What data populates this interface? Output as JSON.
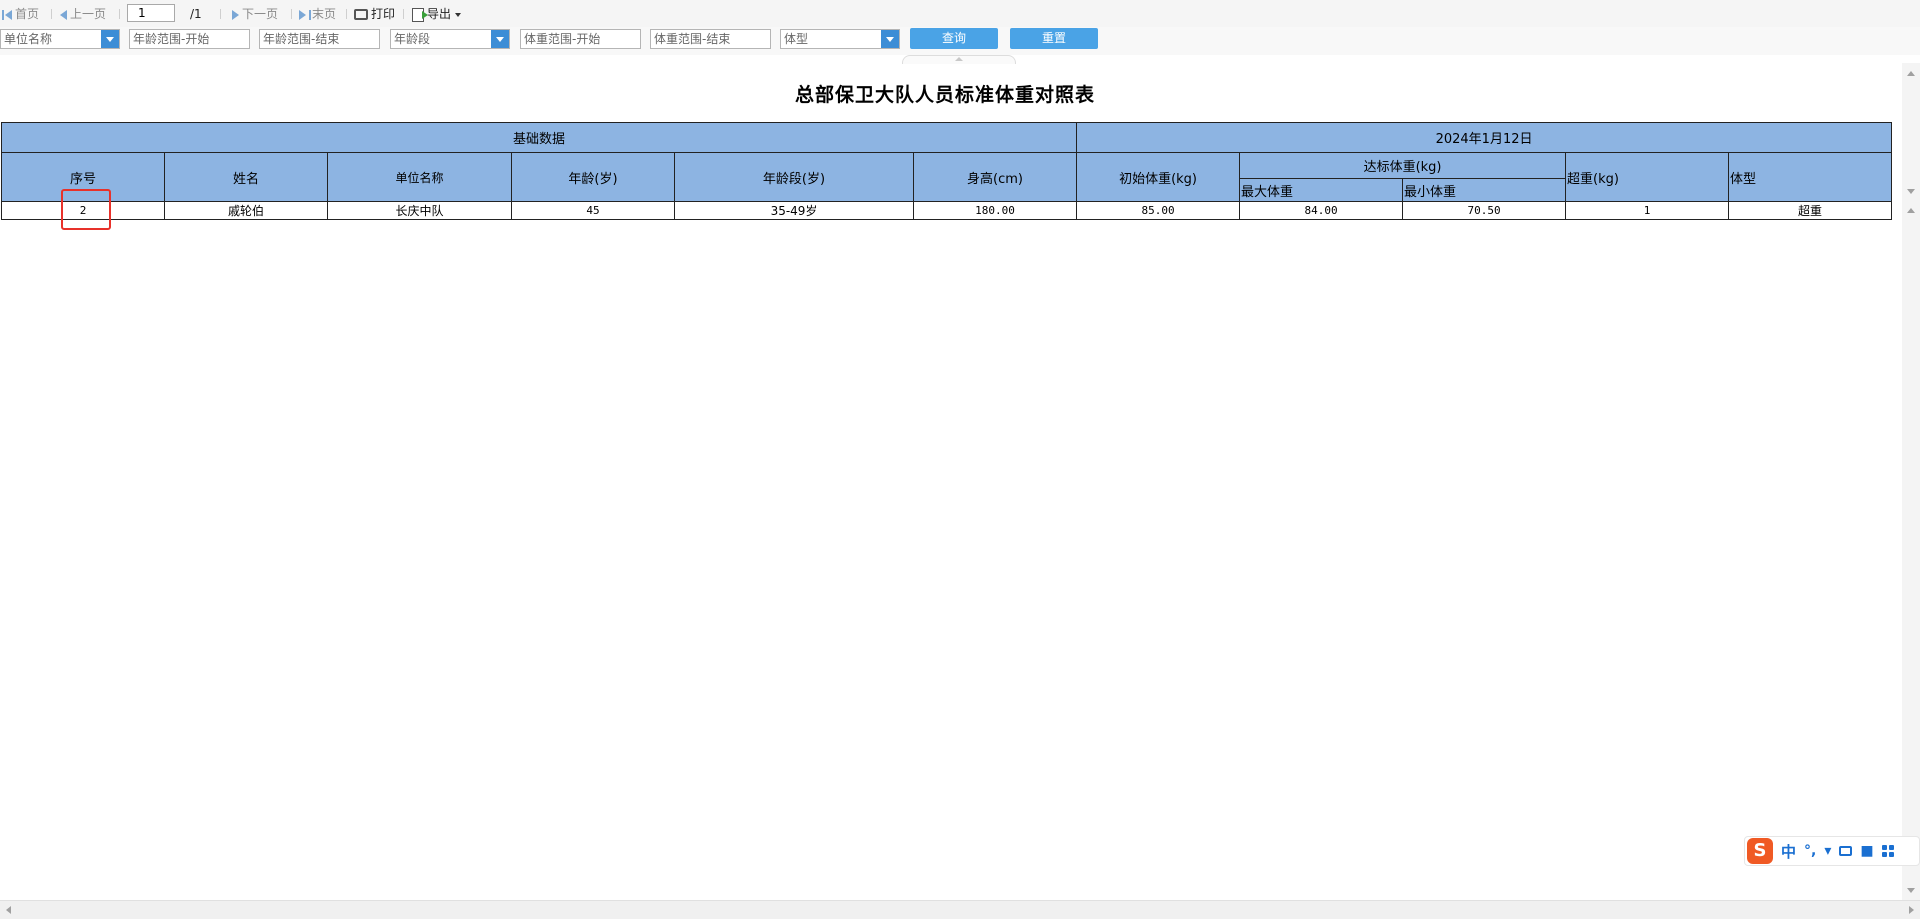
{
  "toolbar": {
    "first_label": "首页",
    "prev_label": "上一页",
    "page_current": "1",
    "page_total": "/1",
    "next_label": "下一页",
    "last_label": "末页",
    "print_label": "打印",
    "export_label": "导出"
  },
  "filters": {
    "unit_name_placeholder": "单位名称",
    "age_start_placeholder": "年龄范围-开始",
    "age_end_placeholder": "年龄范围-结束",
    "age_group_placeholder": "年龄段",
    "weight_start_placeholder": "体重范围-开始",
    "weight_end_placeholder": "体重范围-结束",
    "body_type_placeholder": "体型",
    "query_label": "查询",
    "reset_label": "重置"
  },
  "report": {
    "title": "总部保卫大队人员标准体重对照表",
    "group_basic": "基础数据",
    "group_date": "2024年1月12日",
    "headers": {
      "seq": "序号",
      "name": "姓名",
      "unit": "单位名称",
      "age": "年龄(岁)",
      "age_group": "年龄段(岁)",
      "height": "身高(cm)",
      "initial_weight": "初始体重(kg)",
      "standard_weight": "达标体重(kg)",
      "max_weight": "最大体重",
      "min_weight": "最小体重",
      "overweight": "超重(kg)",
      "body_type": "体型"
    },
    "rows": [
      {
        "seq": "2",
        "name": "戚轮伯",
        "unit": "长庆中队",
        "age": "45",
        "age_group": "35-49岁",
        "height": "180.00",
        "initial_weight": "85.00",
        "max_weight": "84.00",
        "min_weight": "70.50",
        "overweight": "1",
        "body_type": "超重"
      }
    ]
  },
  "ime": {
    "logo": "S",
    "lang": "中",
    "punct": "°,"
  },
  "colors": {
    "header_bg": "#8db4e2",
    "button_bg": "#4aa3e6",
    "highlight": "#e8312a"
  }
}
